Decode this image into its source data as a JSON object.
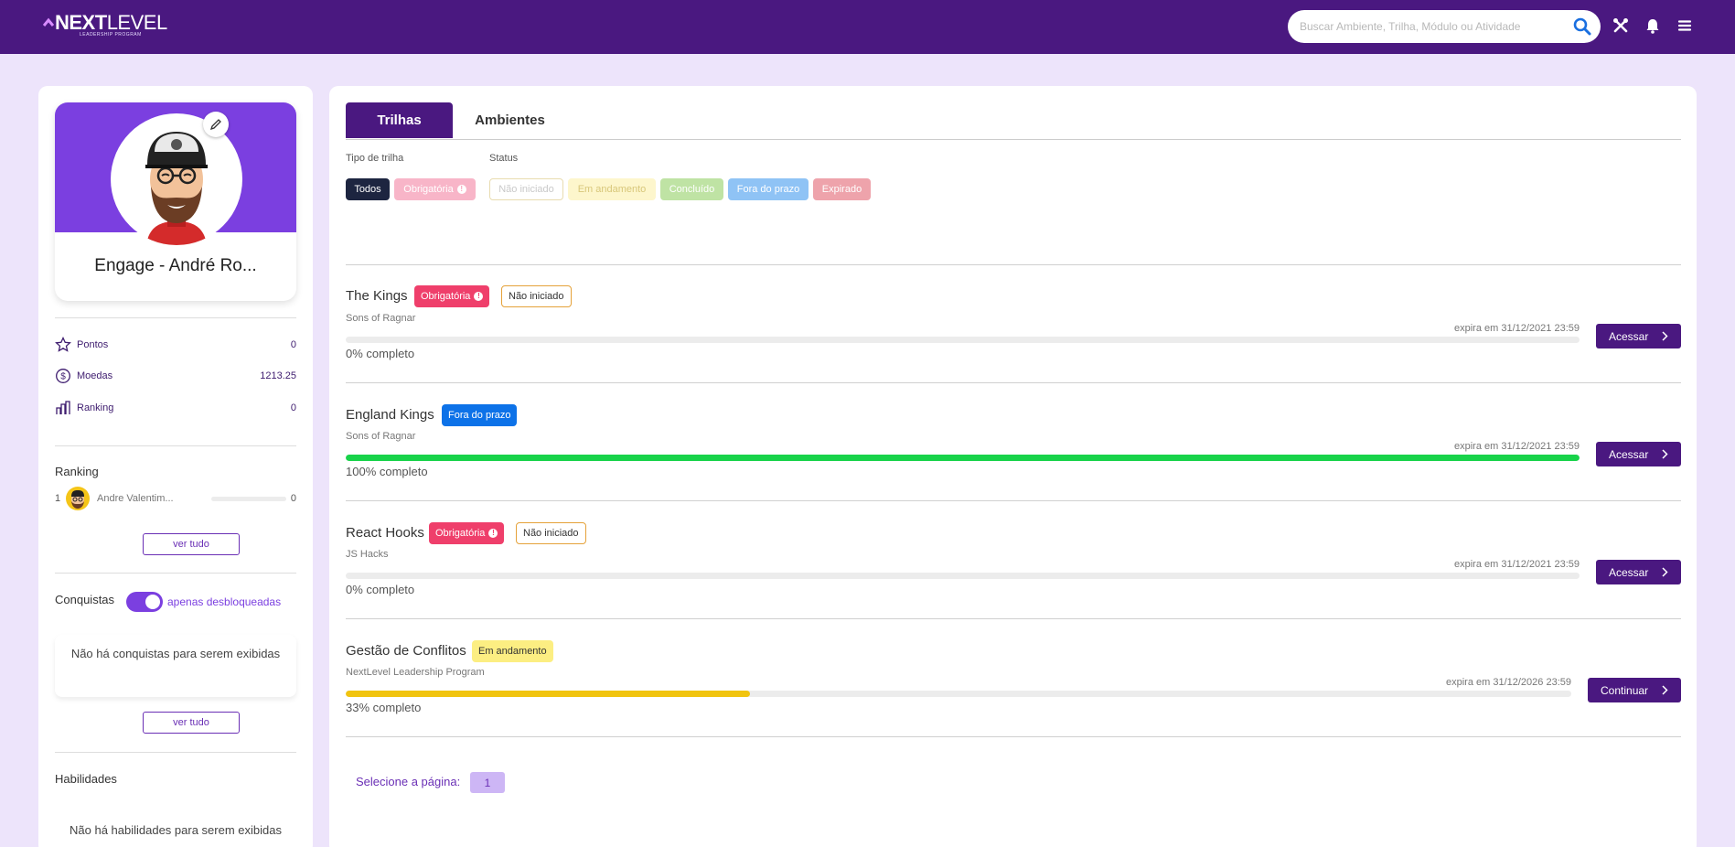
{
  "header": {
    "logo_next": "NEXT",
    "logo_level": "LEVEL",
    "logo_sub": "LEADERSHIP PROGRAM",
    "search_placeholder": "Buscar Ambiente, Trilha, Módulo ou Atividade",
    "icons": [
      "search-icon",
      "tools-icon",
      "bell-icon",
      "menu-icon"
    ],
    "brand_color": "#4a1880"
  },
  "profile": {
    "name": "Engage - André Ro...",
    "stats": [
      {
        "label": "Pontos",
        "value": "0",
        "icon": "star-icon"
      },
      {
        "label": "Moedas",
        "value": "1213.25",
        "icon": "coin-icon"
      },
      {
        "label": "Ranking",
        "value": "0",
        "icon": "ranking-icon"
      }
    ]
  },
  "ranking": {
    "title": "Ranking",
    "rows": [
      {
        "pos": "1",
        "name": "Andre Valentim...",
        "value": "0"
      }
    ],
    "see_all": "ver tudo"
  },
  "achievements": {
    "title": "Conquistas",
    "toggle_label": "apenas desbloqueadas",
    "toggle_on": true,
    "empty": "Não há conquistas para serem exibidas",
    "see_all": "ver tudo"
  },
  "skills": {
    "title": "Habilidades",
    "empty": "Não há habilidades para serem exibidas"
  },
  "tabs": [
    {
      "label": "Trilhas",
      "active": true
    },
    {
      "label": "Ambientes",
      "active": false
    }
  ],
  "filters": {
    "type_label": "Tipo de trilha",
    "status_label": "Status",
    "type_chips": [
      "Todos",
      "Obrigatória"
    ],
    "status_chips": [
      "Não iniciado",
      "Em andamento",
      "Concluído",
      "Fora do prazo",
      "Expirado"
    ]
  },
  "tracks": [
    {
      "title": "The Kings",
      "badges": [
        "Obrigatória",
        "Não iniciado"
      ],
      "subtitle": "Sons of Ragnar",
      "expires": "expira em 31/12/2021 23:59",
      "progress": 0,
      "progress_label": "0% completo",
      "action": "Acessar"
    },
    {
      "title": "England Kings",
      "badges": [
        "Fora do prazo"
      ],
      "subtitle": "Sons of Ragnar",
      "expires": "expira em 31/12/2021 23:59",
      "progress": 100,
      "progress_label": "100% completo",
      "action": "Acessar"
    },
    {
      "title": "React Hooks",
      "badges": [
        "Obrigatória",
        "Não iniciado"
      ],
      "subtitle": "JS Hacks",
      "expires": "expira em 31/12/2021 23:59",
      "progress": 0,
      "progress_label": "0% completo",
      "action": "Acessar"
    },
    {
      "title": "Gestão de Conflitos",
      "badges": [
        "Em andamento"
      ],
      "subtitle": "NextLevel Leadership Program",
      "expires": "expira em 31/12/2026 23:59",
      "progress": 33,
      "progress_label": "33% completo",
      "action": "Continuar"
    }
  ],
  "pager": {
    "label": "Selecione a página:",
    "page": "1"
  }
}
